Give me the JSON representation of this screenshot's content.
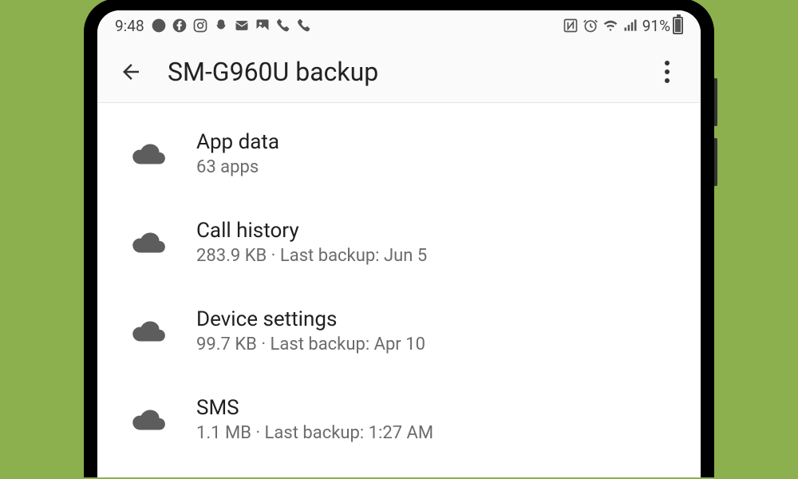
{
  "statusBar": {
    "time": "9:48",
    "battery": "91%"
  },
  "appBar": {
    "title": "SM-G960U backup"
  },
  "items": [
    {
      "title": "App data",
      "subtitle": "63 apps"
    },
    {
      "title": "Call history",
      "subtitle": "283.9 KB · Last backup: Jun 5"
    },
    {
      "title": "Device settings",
      "subtitle": "99.7 KB · Last backup: Apr 10"
    },
    {
      "title": "SMS",
      "subtitle": "1.1 MB · Last backup: 1:27 AM"
    }
  ]
}
